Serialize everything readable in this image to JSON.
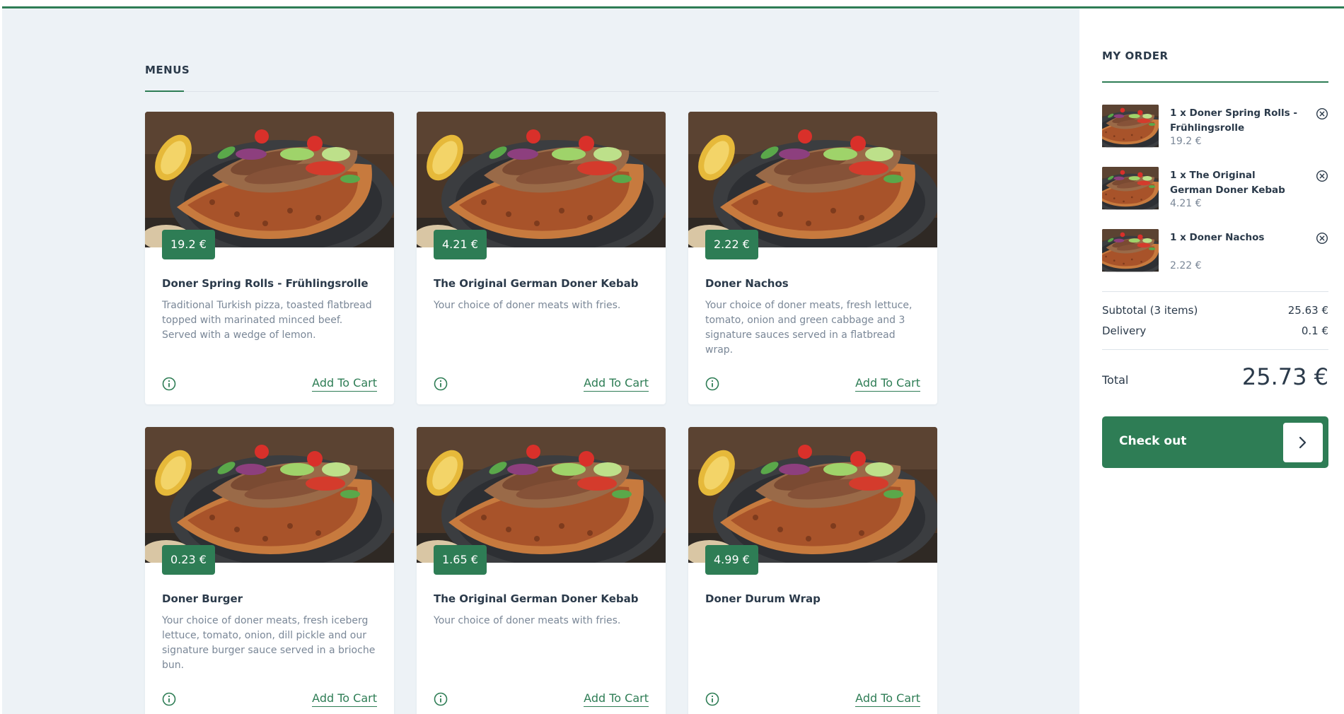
{
  "brand": {
    "accent": "#2e7d55",
    "text": "#2b3a4a",
    "muted": "#7a8797",
    "bg": "#edf2f6"
  },
  "menus": {
    "title": "MENUS",
    "items": [
      {
        "price": "19.2 €",
        "title": "Doner Spring Rolls - Frühlingsrolle",
        "desc": "Traditional Turkish pizza, toasted flatbread topped with marinated minced beef. Served with a wedge of lemon.",
        "cta": "Add To Cart"
      },
      {
        "price": "4.21 €",
        "title": "The Original German Doner Kebab",
        "desc": "Your choice of doner meats with fries.",
        "cta": "Add To Cart"
      },
      {
        "price": "2.22 €",
        "title": "Doner Nachos",
        "desc": "Your choice of doner meats, fresh lettuce, tomato, onion and green cabbage and 3 signature sauces served in a flatbread wrap.",
        "cta": "Add To Cart"
      },
      {
        "price": "0.23 €",
        "title": "Doner Burger",
        "desc": "Your choice of doner meats, fresh iceberg lettuce, tomato, onion, dill pickle and our signature burger sauce served in a brioche bun.",
        "cta": "Add To Cart"
      },
      {
        "price": "1.65 €",
        "title": "The Original German Doner Kebab",
        "desc": "Your choice of doner meats with fries.",
        "cta": "Add To Cart"
      },
      {
        "price": "4.99 €",
        "title": "Doner Durum Wrap",
        "desc": "",
        "cta": "Add To Cart"
      }
    ]
  },
  "order": {
    "title": "MY ORDER",
    "items": [
      {
        "name": "1 x Doner Spring Rolls - Frühlingsrolle",
        "price": "19.2 €"
      },
      {
        "name": "1 x The Original German Doner Kebab",
        "price": "4.21 €"
      },
      {
        "name": "1 x Doner Nachos",
        "price": "2.22 €"
      }
    ],
    "subtotal_label": "Subtotal (3 items)",
    "subtotal_value": "25.63 €",
    "delivery_label": "Delivery",
    "delivery_value": "0.1 €",
    "total_label": "Total",
    "total_value": "25.73 €",
    "checkout_label": "Check out"
  },
  "icons": {
    "info": "info-circle-icon",
    "remove": "close-circle-icon",
    "arrow": "chevron-right-icon"
  }
}
